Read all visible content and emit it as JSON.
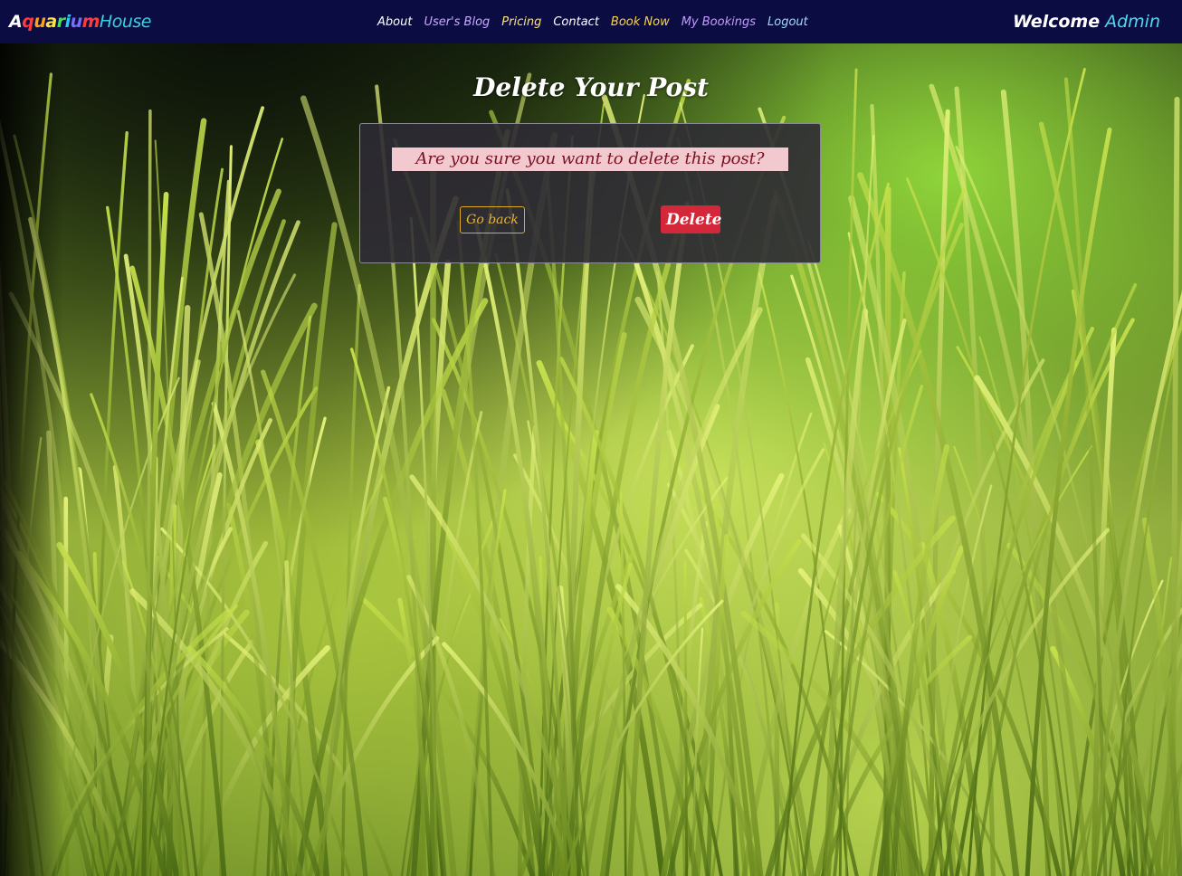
{
  "navbar": {
    "brand_part1": [
      "A",
      "q",
      "u",
      "a",
      "r",
      "i",
      "u",
      "m"
    ],
    "brand_part2": "House",
    "links": {
      "about": "About",
      "blog": "User's Blog",
      "pricing": "Pricing",
      "contact": "Contact",
      "book_now": "Book Now",
      "my_bookings": "My Bookings",
      "logout": "Logout"
    },
    "welcome": "Welcome",
    "username": "Admin"
  },
  "page": {
    "title": "Delete Your Post"
  },
  "confirm": {
    "question": "Are you sure you want to delete this post?",
    "go_back_label": "Go back",
    "delete_label": "Delete"
  },
  "colors": {
    "navbar_bg": "#0b0d42",
    "delete_button": "#d4283a",
    "go_back_border": "#e0a920",
    "question_bg": "#f1c9cf",
    "brand_house": "#36d1e0"
  },
  "background": {
    "description_icon": "aquarium-plants-image"
  }
}
